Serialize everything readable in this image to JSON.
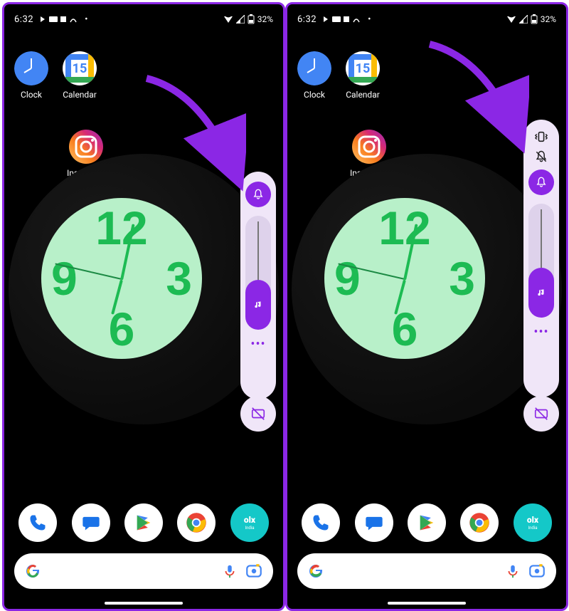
{
  "status": {
    "time": "6:32",
    "battery": "32%"
  },
  "apps": {
    "clock": "Clock",
    "calendar": "Calendar",
    "instagram": "Instagram",
    "calendar_day": "15"
  },
  "clock_widget": {
    "n12": "12",
    "n3": "3",
    "n6": "6",
    "n9": "9"
  },
  "volume_panel": {
    "ring_mode": "ring",
    "slider_percent": 35,
    "options_visible_right": [
      "vibrate",
      "mute"
    ]
  },
  "dock": {
    "items": [
      "phone",
      "messages",
      "play-store",
      "chrome",
      "olx"
    ],
    "olx_label": "olx",
    "olx_sub": "India"
  },
  "search": {
    "placeholder": ""
  },
  "colors": {
    "accent": "#8b27e5",
    "panel": "#f0e6f8",
    "clock_face": "#b8f0c9",
    "clock_num": "#1dbb53"
  }
}
